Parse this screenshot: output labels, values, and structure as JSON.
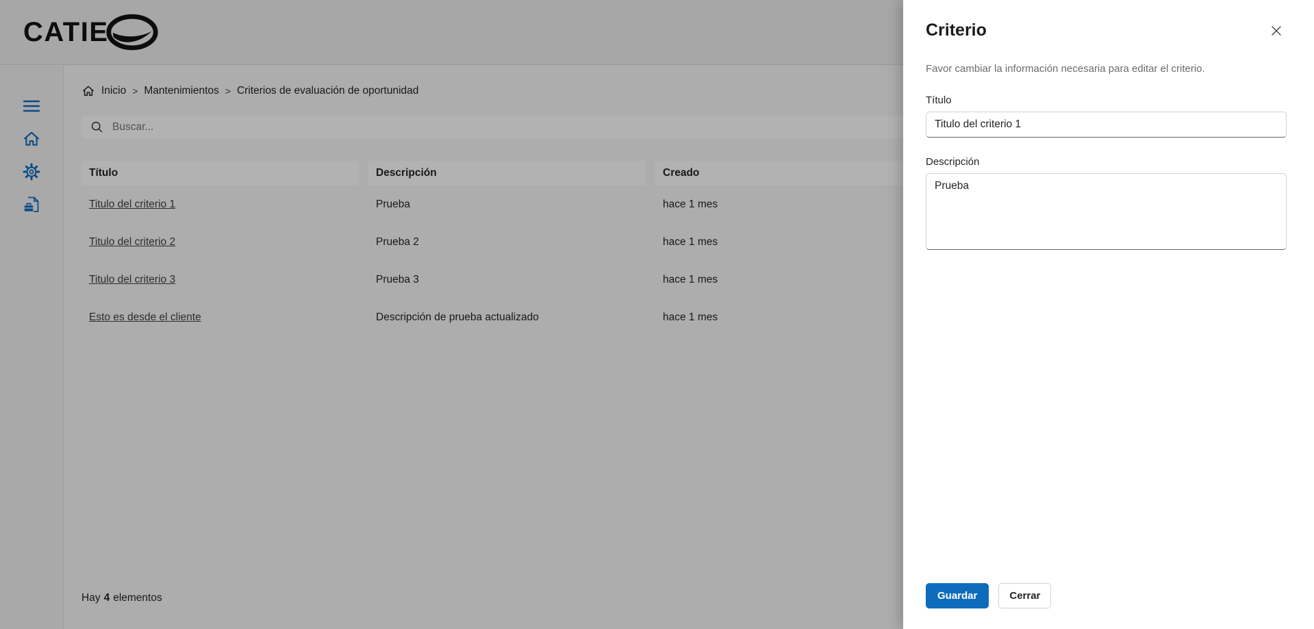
{
  "colors": {
    "brand": "#0f6cbd",
    "link": "#3f3f3f",
    "overlay": "rgba(0,0,0,0.30)"
  },
  "header": {
    "logo_text": "CATIE",
    "logo_mark_icon": "catie-swoosh"
  },
  "sidebar": {
    "icons": [
      "hamburger-menu",
      "home",
      "settings-gear",
      "opportunity-document"
    ]
  },
  "breadcrumb": {
    "home_icon": "home",
    "separator": ">",
    "items": [
      "Inicio",
      "Mantenimientos",
      "Criterios de evaluación de oportunidad"
    ]
  },
  "search": {
    "icon": "magnifier",
    "placeholder": "Buscar..."
  },
  "table": {
    "columns": [
      "Título",
      "Descripción",
      "Creado"
    ],
    "rows": [
      {
        "titulo": "Titulo del criterio 1",
        "descripcion": "Prueba",
        "creado": "hace 1 mes"
      },
      {
        "titulo": "Titulo del criterio 2",
        "descripcion": "Prueba 2",
        "creado": "hace 1 mes"
      },
      {
        "titulo": "Titulo del criterio 3",
        "descripcion": "Prueba 3",
        "creado": "hace 1 mes"
      },
      {
        "titulo": "Esto es desde el cliente",
        "descripcion": "Descripción de prueba actualizado",
        "creado": "hace 1 mes"
      }
    ]
  },
  "summary": {
    "prefix": "Hay",
    "count": "4",
    "suffix": "elementos"
  },
  "drawer": {
    "title": "Criterio",
    "close_icon": "close-x",
    "subtitle": "Favor cambiar la información necesaria para editar el criterio.",
    "fields": {
      "titulo": {
        "label": "Título",
        "value": "Titulo del criterio 1"
      },
      "descripcion": {
        "label": "Descripción",
        "value": "Prueba"
      }
    },
    "buttons": {
      "save": "Guardar",
      "close": "Cerrar"
    }
  }
}
